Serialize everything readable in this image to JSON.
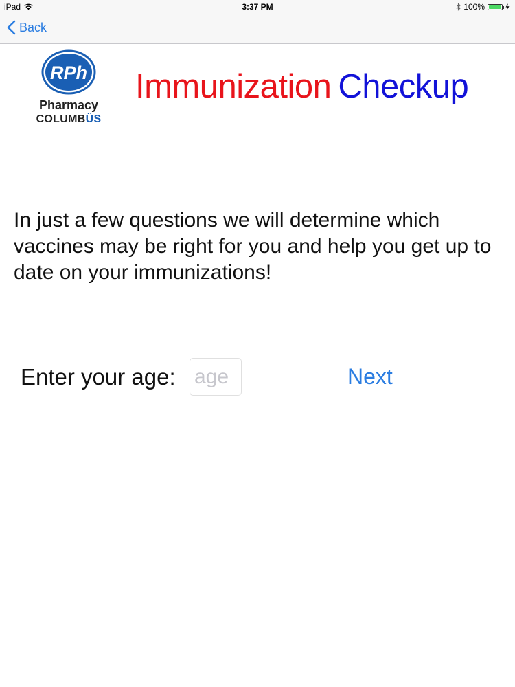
{
  "status_bar": {
    "device": "iPad",
    "time": "3:37 PM",
    "battery_level": "100%",
    "battery_fraction": 1.0
  },
  "nav": {
    "back_label": "Back"
  },
  "logo": {
    "badge_text": "RPh",
    "line1": "Pharmacy",
    "line2_prefix": "COLUMB",
    "line2_accent": "ÜS"
  },
  "header": {
    "title_part1": "Immunization",
    "title_part2": "Checkup"
  },
  "intro_text": "In just a few questions we will determine which vaccines may be right for you and help you get up to date on your immunizations!",
  "age_form": {
    "label": "Enter your age:",
    "placeholder": "age",
    "value": "",
    "next_label": "Next"
  },
  "colors": {
    "accent": "#2b7de1",
    "title_red": "#e8141b",
    "title_blue": "#1212d8",
    "battery_green": "#4cd964"
  }
}
